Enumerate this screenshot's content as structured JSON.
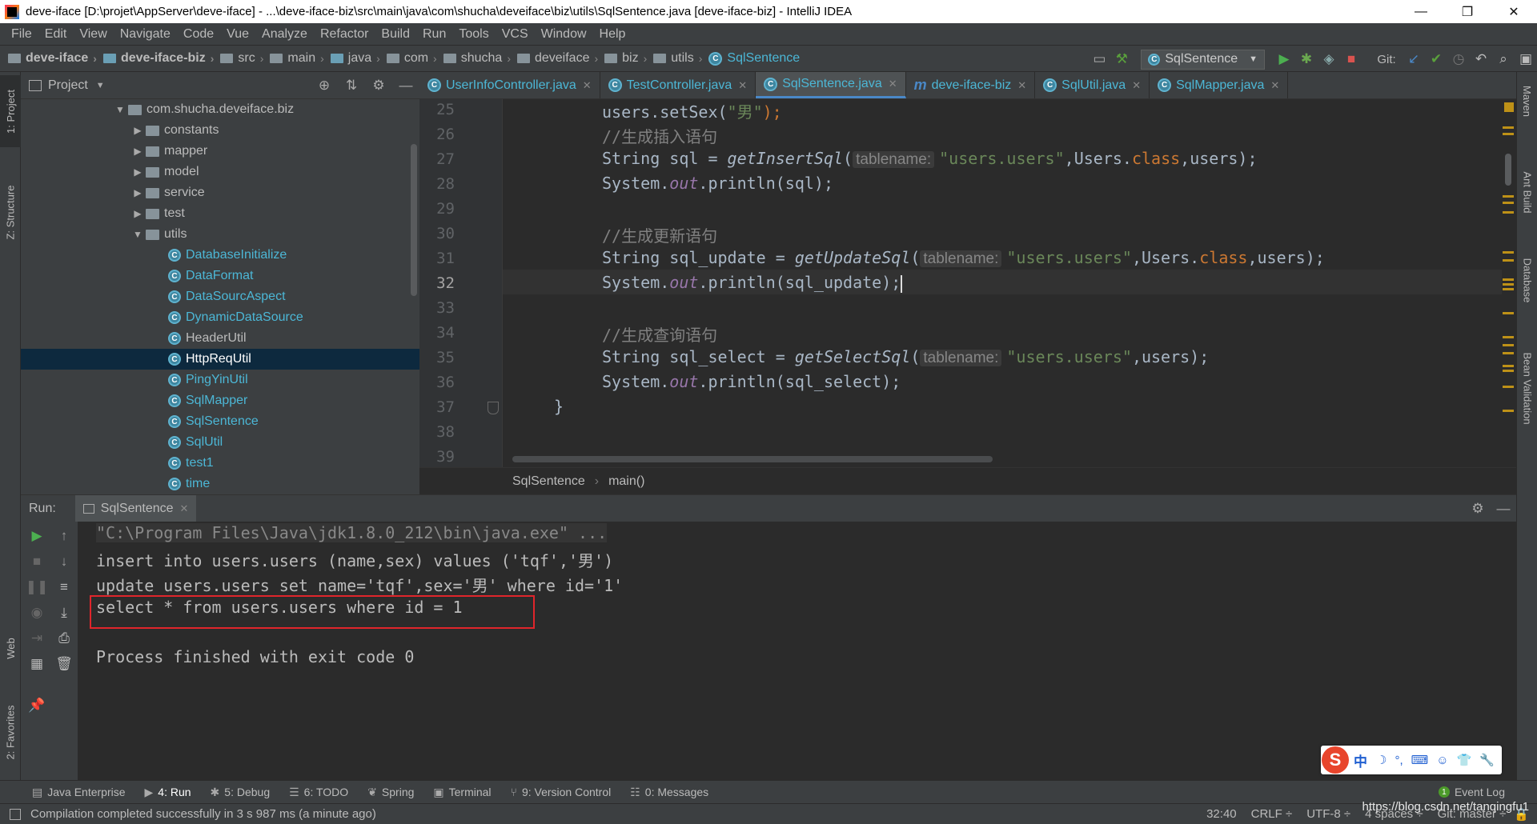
{
  "window": {
    "title": "deve-iface [D:\\projet\\AppServer\\deve-iface] - ...\\deve-iface-biz\\src\\main\\java\\com\\shucha\\deveiface\\biz\\utils\\SqlSentence.java [deve-iface-biz] - IntelliJ IDEA",
    "minimize": "—",
    "restore": "❐",
    "close": "✕"
  },
  "menu": {
    "items": [
      "File",
      "Edit",
      "View",
      "Navigate",
      "Code",
      "Vue",
      "Analyze",
      "Refactor",
      "Build",
      "Run",
      "Tools",
      "VCS",
      "Window",
      "Help"
    ]
  },
  "breadcrumb": {
    "items": [
      "deve-iface",
      "deve-iface-biz",
      "src",
      "main",
      "java",
      "com",
      "shucha",
      "deveiface",
      "biz",
      "utils",
      "SqlSentence"
    ]
  },
  "toolbar": {
    "run_config": "SqlSentence",
    "git_label": "Git:"
  },
  "left_strip": {
    "project": "1: Project",
    "structure": "Z: Structure",
    "web": "Web",
    "favorites": "2: Favorites"
  },
  "right_strip": {
    "maven": "Maven",
    "ant": "Ant Build",
    "database": "Database",
    "bean": "Bean Validation"
  },
  "project": {
    "title": "Project",
    "tree": [
      {
        "label": "com.shucha.deveiface.biz",
        "kind": "package",
        "arrow": "▼"
      },
      {
        "label": "constants",
        "kind": "package",
        "arrow": "▶"
      },
      {
        "label": "mapper",
        "kind": "package",
        "arrow": "▶"
      },
      {
        "label": "model",
        "kind": "package",
        "arrow": "▶"
      },
      {
        "label": "service",
        "kind": "package",
        "arrow": "▶"
      },
      {
        "label": "test",
        "kind": "package",
        "arrow": "▶"
      },
      {
        "label": "utils",
        "kind": "package",
        "arrow": "▼"
      },
      {
        "label": "DatabaseInitialize",
        "kind": "class"
      },
      {
        "label": "DataFormat",
        "kind": "class"
      },
      {
        "label": "DataSourcAspect",
        "kind": "class"
      },
      {
        "label": "DynamicDataSource",
        "kind": "class"
      },
      {
        "label": "HeaderUtil",
        "kind": "class"
      },
      {
        "label": "HttpReqUtil",
        "kind": "class"
      },
      {
        "label": "PingYinUtil",
        "kind": "class"
      },
      {
        "label": "SqlMapper",
        "kind": "class"
      },
      {
        "label": "SqlSentence",
        "kind": "class"
      },
      {
        "label": "SqlUtil",
        "kind": "class"
      },
      {
        "label": "test1",
        "kind": "class"
      },
      {
        "label": "time",
        "kind": "class"
      }
    ]
  },
  "tabs": [
    {
      "label": "UserInfoController.java"
    },
    {
      "label": "TestController.java"
    },
    {
      "label": "SqlSentence.java"
    },
    {
      "label": "deve-iface-biz"
    },
    {
      "label": "SqlUtil.java"
    },
    {
      "label": "SqlMapper.java"
    }
  ],
  "editor": {
    "line_numbers": [
      "25",
      "26",
      "27",
      "28",
      "29",
      "30",
      "31",
      "32",
      "33",
      "34",
      "35",
      "36",
      "37",
      "38",
      "39"
    ],
    "tok": {
      "l25_a": "users.setSex(",
      "l25_s": "\"男\"",
      "l25_b": ");",
      "l26": "//生成插入语句",
      "l27_a": "String sql = ",
      "l27_m": "getInsertSql",
      "l27_p": "(",
      "l27_h": "tablename:",
      "l27_s": "\"users.users\"",
      "l27_b": ",Users.",
      "l27_k": "class",
      "l27_c": ",users);",
      "l28_a": "System.",
      "l28_f": "out",
      "l28_b": ".println(sql);",
      "l30": "//生成更新语句",
      "l31_a": "String sql_update = ",
      "l31_m": "getUpdateSql",
      "l31_p": "(",
      "l31_h": "tablename:",
      "l31_s": "\"users.users\"",
      "l31_b": ",Users.",
      "l31_k": "class",
      "l31_c": ",users);",
      "l32_a": "System.",
      "l32_f": "out",
      "l32_b": ".println(sql_update);",
      "l34": "//生成查询语句",
      "l35_a": "String sql_select = ",
      "l35_m": "getSelectSql",
      "l35_p": "(",
      "l35_h": "tablename:",
      "l35_s": "\"users.users\"",
      "l35_b": ",users);",
      "l36_a": "System.",
      "l36_f": "out",
      "l36_b": ".println(sql_select);",
      "l37": "}"
    },
    "crumb_class": "SqlSentence",
    "crumb_method": "main()"
  },
  "run": {
    "label": "Run:",
    "tab": "SqlSentence",
    "console": [
      "\"C:\\Program Files\\Java\\jdk1.8.0_212\\bin\\java.exe\" ...",
      "insert into users.users (name,sex) values ('tqf','男')",
      "update users.users set name='tqf',sex='男' where id='1'",
      "select * from users.users where id = 1",
      "Process finished with exit code 0"
    ]
  },
  "ime": {
    "logo": "S",
    "lang": "中"
  },
  "tool_tabs": [
    {
      "label": "Java Enterprise"
    },
    {
      "label": "4: Run"
    },
    {
      "label": "5: Debug"
    },
    {
      "label": "6: TODO"
    },
    {
      "label": "Spring"
    },
    {
      "label": "Terminal"
    },
    {
      "label": "9: Version Control"
    },
    {
      "label": "0: Messages"
    }
  ],
  "event_log": "Event Log",
  "status": {
    "message": "Compilation completed successfully in 3 s 987 ms (a minute ago)",
    "position": "32:40",
    "line_sep": "CRLF ÷",
    "encoding": "UTF-8 ÷",
    "indent": "4 spaces ÷",
    "branch": "Git: master ÷"
  },
  "watermark": "https://blog.csdn.net/tanqingfu1"
}
